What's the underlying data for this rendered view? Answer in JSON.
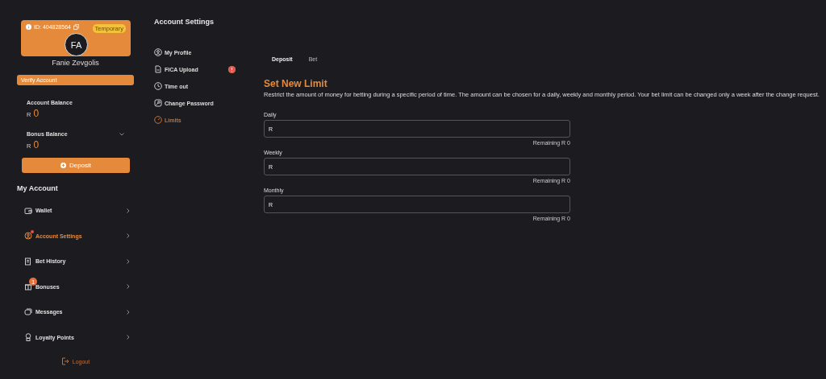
{
  "profile": {
    "id": "ID: 404828564",
    "status": "Temporary",
    "initials": "FA",
    "name": "Fanie Zevgolis",
    "verify": "Verify Account"
  },
  "balances": [
    {
      "label": "Account Balance",
      "currency": "R",
      "amount": "0",
      "kind": "plain"
    },
    {
      "label": "Bonus Balance",
      "currency": "R",
      "amount": "0",
      "kind": "expandable"
    }
  ],
  "deposit_button": "Deposit",
  "menu_title": "My Account",
  "menu": [
    {
      "label": "Wallet",
      "selected": false
    },
    {
      "label": "Account Settings",
      "selected": true,
      "dot": true
    },
    {
      "label": "Bet History",
      "selected": false
    },
    {
      "label": "Bonuses",
      "selected": false,
      "badge": "1"
    },
    {
      "label": "Messages",
      "selected": false
    },
    {
      "label": "Loyalty Points",
      "selected": false
    }
  ],
  "logout": "Logout",
  "settings": {
    "title": "Account Settings",
    "items": [
      {
        "label": "My Profile",
        "selected": false,
        "alert": false
      },
      {
        "label": "FICA Upload",
        "selected": false,
        "alert": true
      },
      {
        "label": "Time out",
        "selected": false,
        "alert": false
      },
      {
        "label": "Change Password",
        "selected": false,
        "alert": false
      },
      {
        "label": "Limits",
        "selected": true,
        "alert": false
      }
    ]
  },
  "tabs": [
    {
      "label": "Deposit",
      "selected": true
    },
    {
      "label": "Bet",
      "selected": false
    }
  ],
  "limit_title": "Set New Limit",
  "description": "Restrict the amount of money for betting during a specific period of time. The amount can be chosen for a daily, weekly and monthly period. Your bet limit can be changed only a week after the change request.",
  "fields": [
    {
      "label": "Daily",
      "value": "R",
      "remaining": "Remaining R 0"
    },
    {
      "label": "Weekly",
      "value": "R",
      "remaining": "Remaining R 0"
    },
    {
      "label": "Monthly",
      "value": "R",
      "remaining": "Remaining R 0"
    }
  ]
}
